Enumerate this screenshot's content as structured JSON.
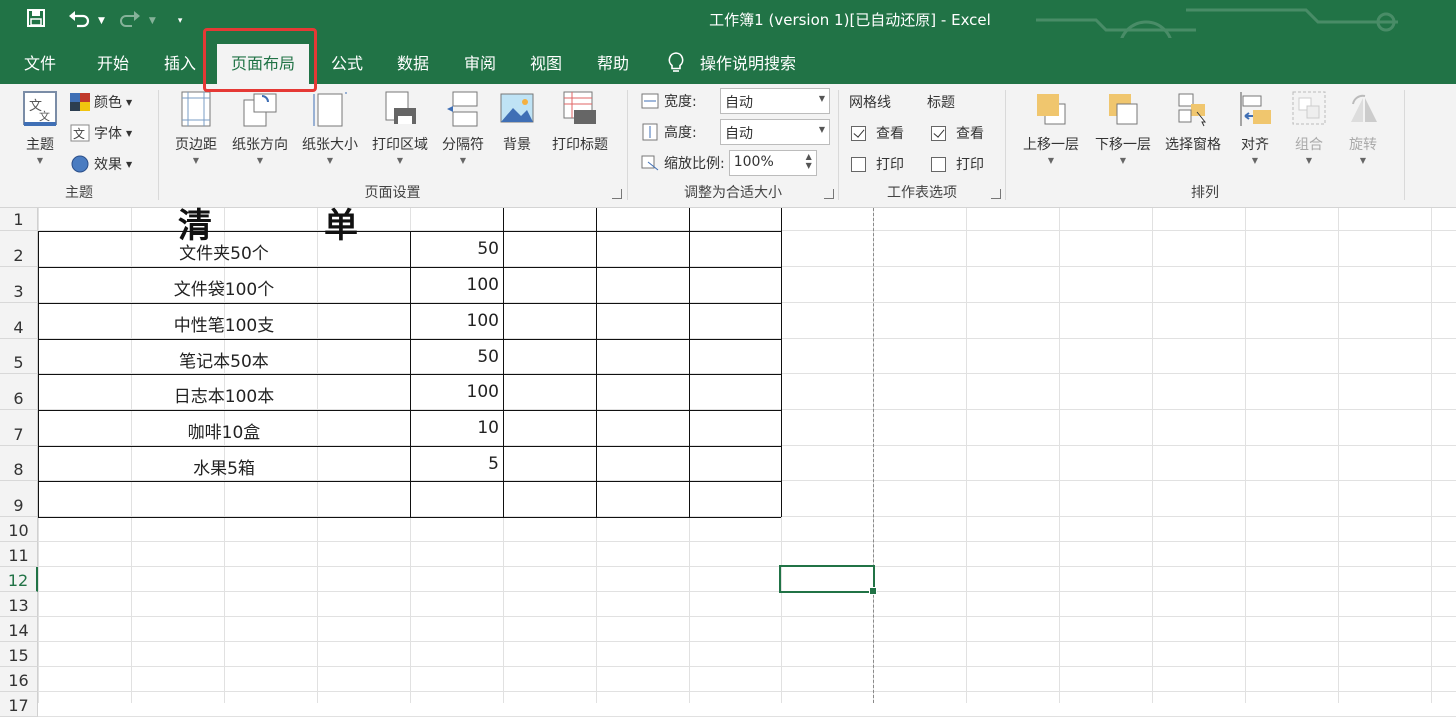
{
  "window": {
    "title": "工作簿1 (version 1)[已自动还原]  -  Excel"
  },
  "qat": {
    "save_icon": "save-icon",
    "undo_icon": "undo-icon",
    "redo_icon": "redo-icon",
    "customize_icon": "customize-qat-icon"
  },
  "tabs": [
    "文件",
    "开始",
    "插入",
    "页面布局",
    "公式",
    "数据",
    "审阅",
    "视图",
    "帮助"
  ],
  "active_tab": "页面布局",
  "search": {
    "label": "操作说明搜索",
    "icon": "lightbulb-icon"
  },
  "ribbon": {
    "theme": {
      "label": "主题",
      "colors": "颜色",
      "fonts": "字体",
      "effects": "效果",
      "group": "主题"
    },
    "page_setup": {
      "margins": "页边距",
      "orientation": "纸张方向",
      "size": "纸张大小",
      "print_area": "打印区域",
      "breaks": "分隔符",
      "background": "背景",
      "print_titles": "打印标题",
      "group": "页面设置"
    },
    "scale": {
      "width_label": "宽度:",
      "width_value": "自动",
      "height_label": "高度:",
      "height_value": "自动",
      "scale_label": "缩放比例:",
      "scale_value": "100%",
      "group": "调整为合适大小"
    },
    "sheet_options": {
      "gridlines": "网格线",
      "headings": "标题",
      "grid_view": "查看",
      "grid_print": "打印",
      "head_view": "查看",
      "head_print": "打印",
      "grid_view_checked": true,
      "head_view_checked": true,
      "group": "工作表选项"
    },
    "arrange": {
      "bring_forward": "上移一层",
      "send_backward": "下移一层",
      "selection_pane": "选择窗格",
      "align": "对齐",
      "group_btn": "组合",
      "rotate": "旋转",
      "group": "排列"
    }
  },
  "sheet": {
    "row_numbers": [
      "1",
      "2",
      "3",
      "4",
      "5",
      "6",
      "7",
      "8",
      "9",
      "10",
      "11",
      "12",
      "13",
      "14",
      "15",
      "16",
      "17"
    ],
    "selected_row": "12",
    "title_chars": [
      "清",
      "单"
    ],
    "items": [
      {
        "name": "文件夹50个",
        "qty": "50"
      },
      {
        "name": "文件袋100个",
        "qty": "100"
      },
      {
        "name": "中性笔100支",
        "qty": "100"
      },
      {
        "name": "笔记本50本",
        "qty": "50"
      },
      {
        "name": "日志本100本",
        "qty": "100"
      },
      {
        "name": "咖啡10盒",
        "qty": "10"
      },
      {
        "name": "水果5箱",
        "qty": "5"
      }
    ]
  },
  "colors": {
    "accent": "#217346",
    "highlight": "#e53935"
  }
}
